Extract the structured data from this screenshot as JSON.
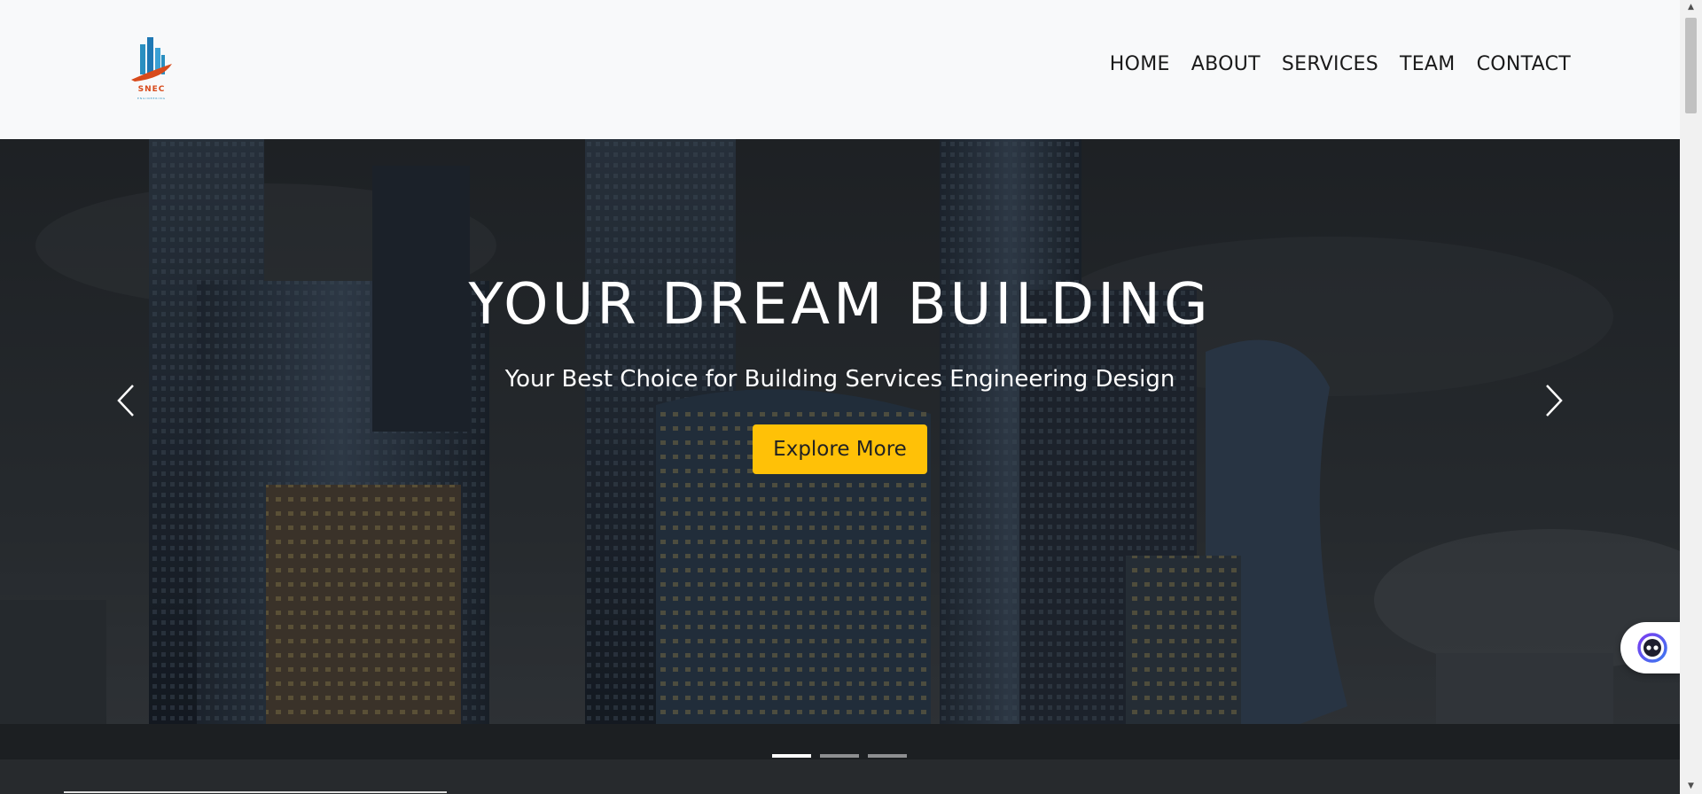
{
  "header": {
    "logo_text": "SNEC",
    "logo_subtext": "ENGINEERING",
    "nav": [
      {
        "label": "HOME"
      },
      {
        "label": "ABOUT"
      },
      {
        "label": "SERVICES"
      },
      {
        "label": "TEAM"
      },
      {
        "label": "CONTACT"
      }
    ]
  },
  "hero": {
    "title": "YOUR DREAM BUILDING",
    "subtitle": "Your Best Choice for Building Services Engineering Design",
    "cta_label": "Explore More",
    "slide_count": 3,
    "active_slide": 1
  },
  "colors": {
    "accent": "#ffc107",
    "header_bg": "#f8f9fa",
    "logo_blue": "#2a8fc0",
    "logo_orange": "#d84a1b"
  },
  "icons": {
    "prev": "chevron-left-icon",
    "next": "chevron-right-icon",
    "chat": "chatbot-icon"
  }
}
